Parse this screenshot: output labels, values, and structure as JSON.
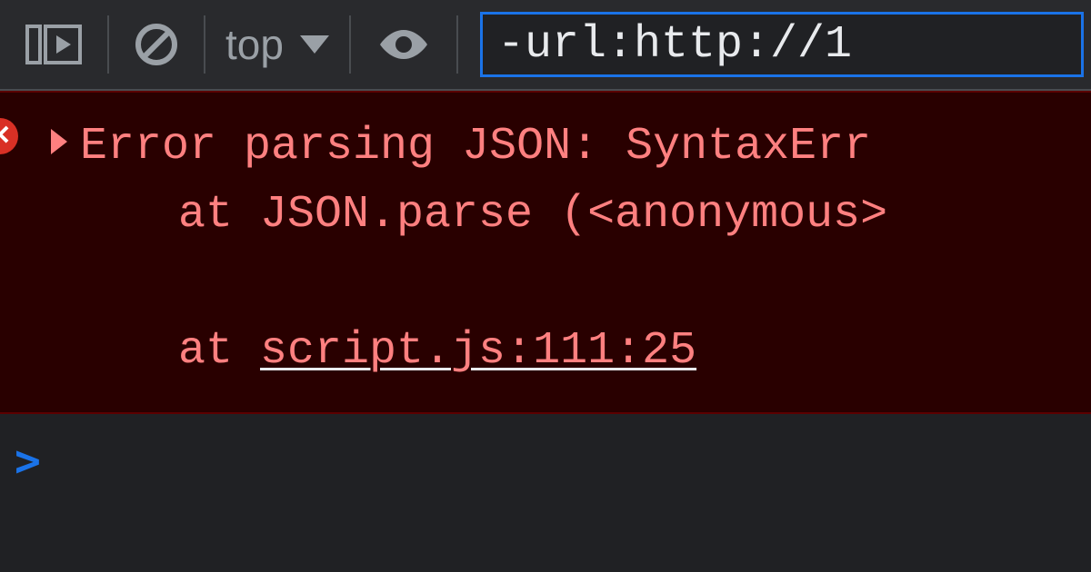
{
  "toolbar": {
    "context_label": "top",
    "filter_value": "-url:http://1"
  },
  "error": {
    "message": "Error parsing JSON: SyntaxErr",
    "stack_line1_prefix": "at JSON.parse (",
    "stack_line1_anon": "<anonymous>",
    "stack_line2_prefix": "at ",
    "stack_line2_link": "script.js:111:25"
  },
  "prompt": {
    "symbol": ">"
  }
}
